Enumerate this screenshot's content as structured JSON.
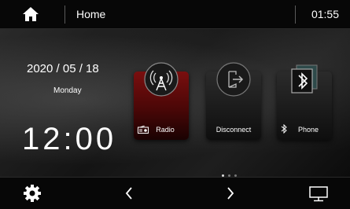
{
  "topbar": {
    "title": "Home",
    "time": "01:55",
    "home_icon": "home-icon"
  },
  "clock_widget": {
    "date": "2020 / 05 / 18",
    "weekday": "Monday",
    "time": "12:00"
  },
  "apps": [
    {
      "label": "Radio",
      "icon": "radio-tower-icon",
      "active": true,
      "color": "#7a0f0f"
    },
    {
      "label": "Disconnect",
      "icon": "disconnect-icon",
      "active": false
    },
    {
      "label": "Phone",
      "icon": "bluetooth-icon",
      "active": false
    }
  ],
  "pager": {
    "pages": 3,
    "current": 1
  },
  "bottombar": {
    "settings_icon": "gear-icon",
    "prev_icon": "chevron-left-icon",
    "next_icon": "chevron-right-icon",
    "screen_icon": "monitor-icon"
  }
}
